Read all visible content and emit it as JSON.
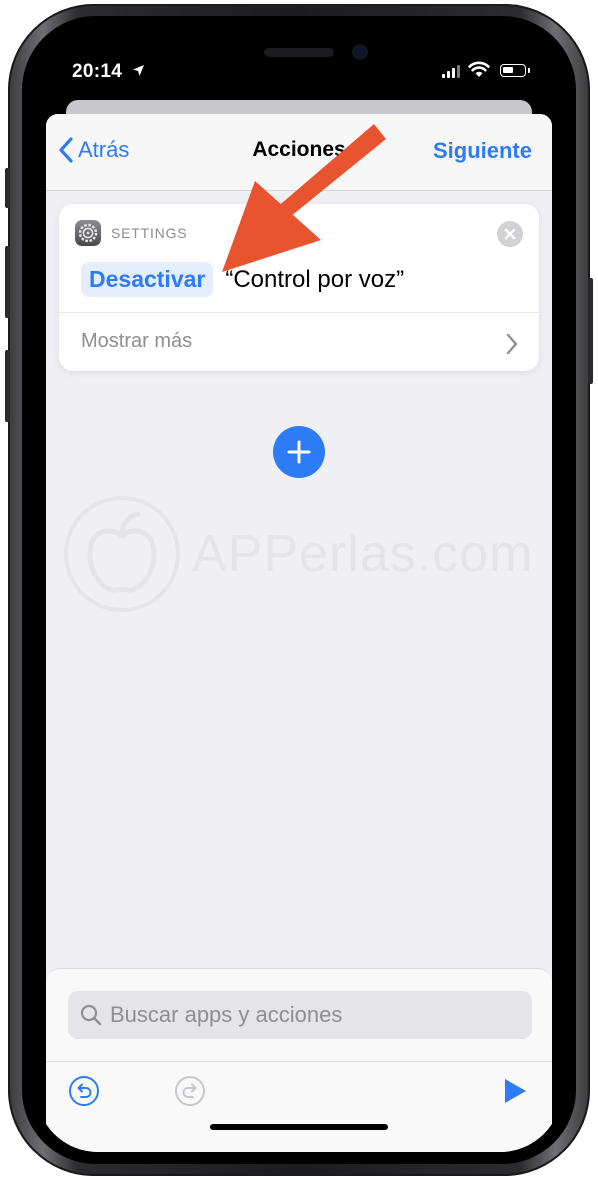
{
  "status_bar": {
    "time": "20:14",
    "location_icon": "location-arrow-icon",
    "signal_icon": "cellular-signal-icon",
    "wifi_icon": "wifi-icon",
    "battery_icon": "battery-icon",
    "battery_level": 0.55
  },
  "nav": {
    "back_label": "Atrás",
    "title": "Acciones",
    "next_label": "Siguiente"
  },
  "action_card": {
    "app_name": "SETTINGS",
    "app_icon": "settings-gear-icon",
    "verb": "Desactivar",
    "target": "“Control por voz”",
    "show_more_label": "Mostrar más"
  },
  "search": {
    "placeholder": "Buscar apps y acciones"
  },
  "watermark": {
    "text": "APPerlas.com"
  },
  "colors": {
    "accent": "#2d7cf6",
    "annotation_arrow": "#e8542f",
    "sheet_background": "#efeff4"
  }
}
